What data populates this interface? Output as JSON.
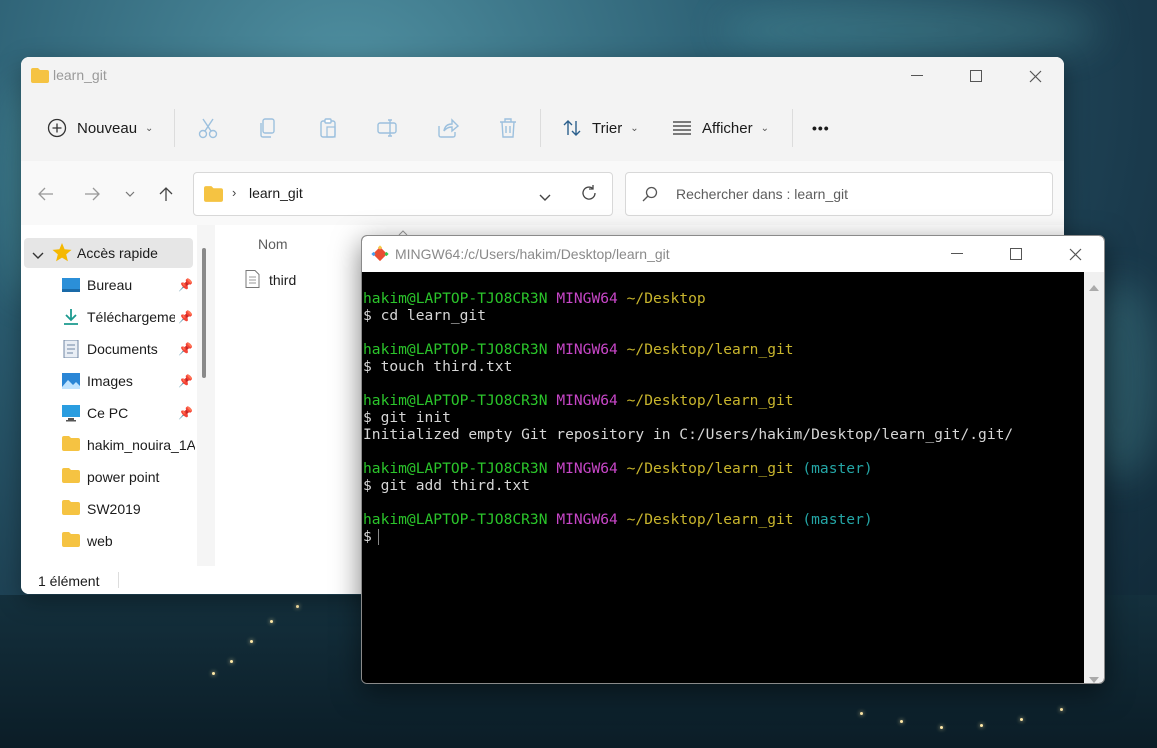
{
  "explorer": {
    "title": "learn_git",
    "toolbar": {
      "new_label": "Nouveau",
      "sort_label": "Trier",
      "view_label": "Afficher",
      "more_label": "•••"
    },
    "address": {
      "path": "learn_git"
    },
    "search": {
      "placeholder": "Rechercher dans : learn_git"
    },
    "sidebar": {
      "quick_access": "Accès rapide",
      "items": [
        {
          "label": "Bureau",
          "pinned": true
        },
        {
          "label": "Téléchargements",
          "pinned": true
        },
        {
          "label": "Documents",
          "pinned": true
        },
        {
          "label": "Images",
          "pinned": true
        },
        {
          "label": "Ce PC",
          "pinned": true
        },
        {
          "label": "hakim_nouira_1A",
          "pinned": false
        },
        {
          "label": "power point",
          "pinned": false
        },
        {
          "label": "SW2019",
          "pinned": false
        },
        {
          "label": "web",
          "pinned": false
        }
      ]
    },
    "columns": {
      "name": "Nom"
    },
    "files": [
      {
        "name": "third"
      }
    ],
    "status": "1 élément"
  },
  "terminal": {
    "title": "MINGW64:/c/Users/hakim/Desktop/learn_git",
    "lines": {
      "p1_user": "hakim@LAPTOP-TJO8CR3N",
      "p1_env": "MINGW64",
      "p1_path": "~/Desktop",
      "c1": "$ cd learn_git",
      "p2_user": "hakim@LAPTOP-TJO8CR3N",
      "p2_env": "MINGW64",
      "p2_path": "~/Desktop/learn_git",
      "c2": "$ touch third.txt",
      "p3_user": "hakim@LAPTOP-TJO8CR3N",
      "p3_env": "MINGW64",
      "p3_path": "~/Desktop/learn_git",
      "c3": "$ git init",
      "o3": "Initialized empty Git repository in C:/Users/hakim/Desktop/learn_git/.git/",
      "p4_user": "hakim@LAPTOP-TJO8CR3N",
      "p4_env": "MINGW64",
      "p4_path": "~/Desktop/learn_git",
      "p4_branch": "(master)",
      "c4": "$ git add third.txt",
      "p5_user": "hakim@LAPTOP-TJO8CR3N",
      "p5_env": "MINGW64",
      "p5_path": "~/Desktop/learn_git",
      "p5_branch": "(master)",
      "c5": "$"
    }
  },
  "colors": {
    "term_user": "#2bc52b",
    "term_env": "#c746c7",
    "term_path": "#c8b52d",
    "term_branch": "#24a6a6",
    "folder": "#f5c342",
    "star": "#f5b800"
  }
}
